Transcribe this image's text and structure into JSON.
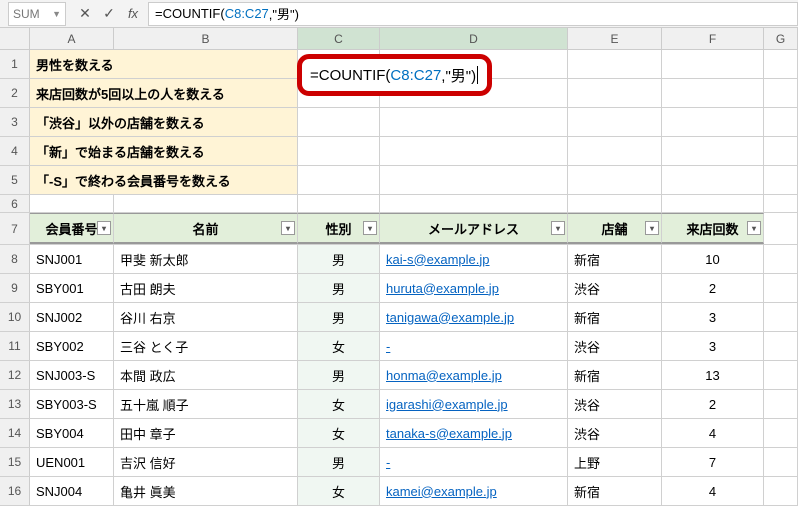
{
  "formula_bar": {
    "name_box": "SUM",
    "cancel_icon": "✕",
    "enter_icon": "✓",
    "fx_icon": "fx",
    "formula_text_pre": "=COUNTIF(",
    "formula_range": "C8:C27",
    "formula_text_post": ",\"男\")"
  },
  "columns": [
    "A",
    "B",
    "C",
    "D",
    "E",
    "F",
    "G"
  ],
  "edit_cell": {
    "pre": "=COUNTIF(",
    "range": "C8:C27",
    "post": ",\"男\")"
  },
  "yellow_labels": [
    "男性を数える",
    "来店回数が5回以上の人を数える",
    "「渋谷」以外の店舗を数える",
    "「新」で始まる店舗を数える",
    "「-S」で終わる会員番号を数える"
  ],
  "table_headers": [
    "会員番号",
    "名前",
    "性別",
    "メールアドレス",
    "店舗",
    "来店回数"
  ],
  "rows": [
    {
      "r": "8",
      "id": "SNJ001",
      "name": "甲斐 新太郎",
      "sex": "男",
      "mail": "kai-s@example.jp",
      "store": "新宿",
      "visits": "10"
    },
    {
      "r": "9",
      "id": "SBY001",
      "name": "古田 朗夫",
      "sex": "男",
      "mail": "huruta@example.jp",
      "store": "渋谷",
      "visits": "2"
    },
    {
      "r": "10",
      "id": "SNJ002",
      "name": "谷川 右京",
      "sex": "男",
      "mail": "tanigawa@example.jp",
      "store": "新宿",
      "visits": "3"
    },
    {
      "r": "11",
      "id": "SBY002",
      "name": "三谷 とく子",
      "sex": "女",
      "mail": "-",
      "store": "渋谷",
      "visits": "3"
    },
    {
      "r": "12",
      "id": "SNJ003-S",
      "name": "本間 政広",
      "sex": "男",
      "mail": "honma@example.jp",
      "store": "新宿",
      "visits": "13"
    },
    {
      "r": "13",
      "id": "SBY003-S",
      "name": "五十嵐 順子",
      "sex": "女",
      "mail": "igarashi@example.jp",
      "store": "渋谷",
      "visits": "2"
    },
    {
      "r": "14",
      "id": "SBY004",
      "name": "田中 章子",
      "sex": "女",
      "mail": "tanaka-s@example.jp",
      "store": "渋谷",
      "visits": "4"
    },
    {
      "r": "15",
      "id": "UEN001",
      "name": "吉沢 信好",
      "sex": "男",
      "mail": "-",
      "store": "上野",
      "visits": "7"
    },
    {
      "r": "16",
      "id": "SNJ004",
      "name": "亀井 眞美",
      "sex": "女",
      "mail": "kamei@example.jp",
      "store": "新宿",
      "visits": "4"
    }
  ]
}
